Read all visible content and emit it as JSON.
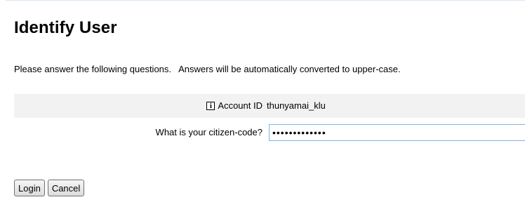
{
  "page": {
    "title": "Identify User",
    "instructions": "Please answer the following questions.   Answers will be automatically converted to upper-case."
  },
  "form": {
    "account": {
      "icon": "info-icon",
      "icon_glyph": "i",
      "label": "Account ID",
      "value": "thunyamai_klu"
    },
    "citizen_code": {
      "label": "What is your citizen-code?",
      "value": "•••••••••••••"
    }
  },
  "buttons": {
    "login_label": "Login",
    "cancel_label": "Cancel"
  },
  "colors": {
    "row_shade": "#f2f2f2",
    "input_focus_border": "#7eb4ea"
  }
}
